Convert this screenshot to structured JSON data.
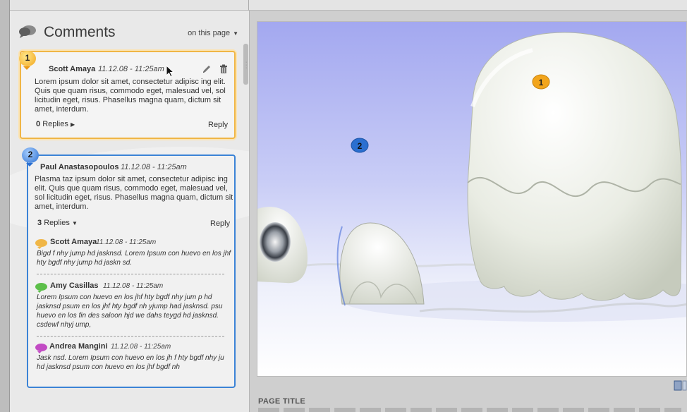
{
  "panel": {
    "title": "Comments",
    "scope_label": "on this page"
  },
  "comments": [
    {
      "number": "1",
      "author": "Scott Amaya",
      "date": "11.12.08 - 11:25am",
      "text": "Lorem ipsum dolor sit amet, consectetur adipisc ing elit. Quis que quam risus, commodo eget, malesuad vel, sol licitudin eget, risus. Phasellus magna quam, dictum sit amet, interdum.",
      "replies_count": "0",
      "replies_label": "Replies",
      "reply_label": "Reply",
      "color": "#f0b646"
    },
    {
      "number": "2",
      "author": "Paul Anastasopoulos",
      "date": "11.12.08 - 11:25am",
      "text": "Plasma taz ipsum dolor sit amet, consectetur adipisc ing elit. Quis que quam risus, commodo eget, malesuad vel, sol licitudin eget, risus. Phasellus magna quam, dictum sit amet, interdum.",
      "replies_count": "3",
      "replies_label": "Replies",
      "reply_label": "Reply",
      "color": "#3b83d6",
      "replies": [
        {
          "author": "Scott Amaya",
          "date": "11.12.08 - 11:25am",
          "text": "Bigd f nhy jump hd jasknsd. Lorem Ipsum con huevo en los jhf hty bgdf nhy jump hd jaskn sd.",
          "bubble_color": "#f0b646"
        },
        {
          "author": "Amy Casillas",
          "date": "11.12.08 - 11:25am",
          "text": "Lorem Ipsum con huevo en los jhf hty bgdf nhy jum p hd jasknsd  psum en los jhf hty bgdf nh yjump had jasknsd. psu huevo en los fin des saloon hjd we dahs teygd  hd jasknsd. csdewf nhyj ump,",
          "bubble_color": "#5cbf4a"
        },
        {
          "author": "Andrea Mangini",
          "date": "11.12.08 - 11:25am",
          "text": "Jask nsd. Lorem Ipsum con huevo en los jh f hty bgdf nhy ju hd jasknsd  psum con huevo en los jhf  bgdf  nh",
          "bubble_color": "#c24bc4"
        }
      ]
    }
  ],
  "image_markers": [
    "1",
    "2"
  ],
  "page": {
    "title": "PAGE TITLE"
  }
}
